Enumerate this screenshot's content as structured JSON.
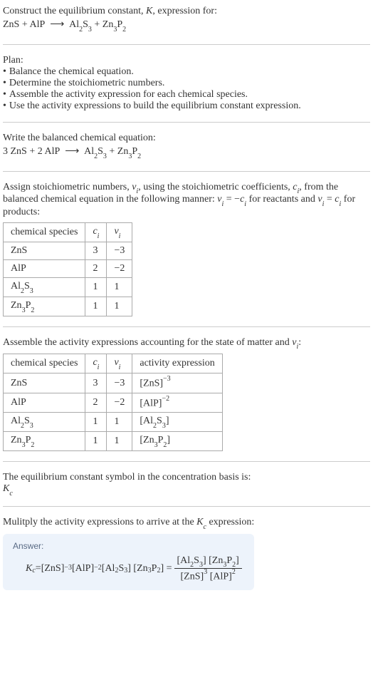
{
  "intro": {
    "prompt": "Construct the equilibrium constant, K, expression for:",
    "unbalanced_lhs_1": "ZnS",
    "unbalanced_lhs_2": "AlP",
    "unbalanced_rhs_1_base": "Al",
    "unbalanced_rhs_1_sub1": "2",
    "unbalanced_rhs_1_mid": "S",
    "unbalanced_rhs_1_sub2": "3",
    "unbalanced_rhs_2_base": "Zn",
    "unbalanced_rhs_2_sub1": "3",
    "unbalanced_rhs_2_mid": "P",
    "unbalanced_rhs_2_sub2": "2",
    "plus": "+",
    "arrow": "⟶"
  },
  "plan": {
    "heading": "Plan:",
    "items": [
      "Balance the chemical equation.",
      "Determine the stoichiometric numbers.",
      "Assemble the activity expression for each chemical species.",
      "Use the activity expressions to build the equilibrium constant expression."
    ],
    "bullet": "•"
  },
  "balanced": {
    "heading": "Write the balanced chemical equation:",
    "coef1": "3",
    "sp1": "ZnS",
    "coef2": "2",
    "sp2": "AlP"
  },
  "stoich": {
    "text_before": "Assign stoichiometric numbers, ",
    "nu": "ν",
    "sub_i": "i",
    "text_mid1": ", using the stoichiometric coefficients, ",
    "c": "c",
    "text_mid2": ", from the balanced chemical equation in the following manner: ",
    "rel1_a": "ν",
    "rel1_b": " = −",
    "rel1_c": "c",
    "text_mid3": " for reactants and ",
    "rel2_b": " = ",
    "text_end": " for products:",
    "headers": [
      "chemical species",
      "cᵢ",
      "νᵢ"
    ],
    "rows": [
      {
        "species": "ZnS",
        "c": "3",
        "nu": "−3",
        "has_sub": false
      },
      {
        "species": "AlP",
        "c": "2",
        "nu": "−2",
        "has_sub": false
      },
      {
        "species_base1": "Al",
        "species_sub1": "2",
        "species_base2": "S",
        "species_sub2": "3",
        "c": "1",
        "nu": "1",
        "has_sub": true
      },
      {
        "species_base1": "Zn",
        "species_sub1": "3",
        "species_base2": "P",
        "species_sub2": "2",
        "c": "1",
        "nu": "1",
        "has_sub": true
      }
    ]
  },
  "activity": {
    "heading_a": "Assemble the activity expressions accounting for the state of matter and ",
    "heading_b": ":",
    "headers": [
      "chemical species",
      "cᵢ",
      "νᵢ",
      "activity expression"
    ],
    "rows": [
      {
        "species": "ZnS",
        "c": "3",
        "nu": "−3",
        "expr_base": "[ZnS]",
        "expr_sup": "−3",
        "has_sub": false,
        "has_sup": true
      },
      {
        "species": "AlP",
        "c": "2",
        "nu": "−2",
        "expr_base": "[AlP]",
        "expr_sup": "−2",
        "has_sub": false,
        "has_sup": true
      },
      {
        "species_base1": "Al",
        "species_sub1": "2",
        "species_base2": "S",
        "species_sub2": "3",
        "c": "1",
        "nu": "1",
        "expr_pre": "[Al",
        "expr_sub1": "2",
        "expr_mid": "S",
        "expr_sub2": "3",
        "expr_post": "]",
        "has_sub": true,
        "has_sup": false
      },
      {
        "species_base1": "Zn",
        "species_sub1": "3",
        "species_base2": "P",
        "species_sub2": "2",
        "c": "1",
        "nu": "1",
        "expr_pre": "[Zn",
        "expr_sub1": "3",
        "expr_mid": "P",
        "expr_sub2": "2",
        "expr_post": "]",
        "has_sub": true,
        "has_sup": false
      }
    ]
  },
  "symbol": {
    "text": "The equilibrium constant symbol in the concentration basis is:",
    "K": "K",
    "sub_c": "c"
  },
  "multiply": {
    "text_a": "Mulitply the activity expressions to arrive at the ",
    "text_b": " expression:"
  },
  "answer": {
    "label": "Answer:",
    "eq": " = ",
    "t1": "[ZnS]",
    "e1": "−3",
    "t2": " [AlP]",
    "e2": "−2",
    "t3": " [Al",
    "s3a": "2",
    "t3b": "S",
    "s3b": "3",
    "t3c": "] [Zn",
    "s4a": "3",
    "t4b": "P",
    "s4b": "2",
    "t4c": "] = ",
    "num_a": "[Al",
    "num_b": "S",
    "num_c": "] [Zn",
    "num_d": "P",
    "num_e": "]",
    "den_a": "[ZnS]",
    "den_exp1": "3",
    "den_b": " [AlP]",
    "den_exp2": "2"
  }
}
